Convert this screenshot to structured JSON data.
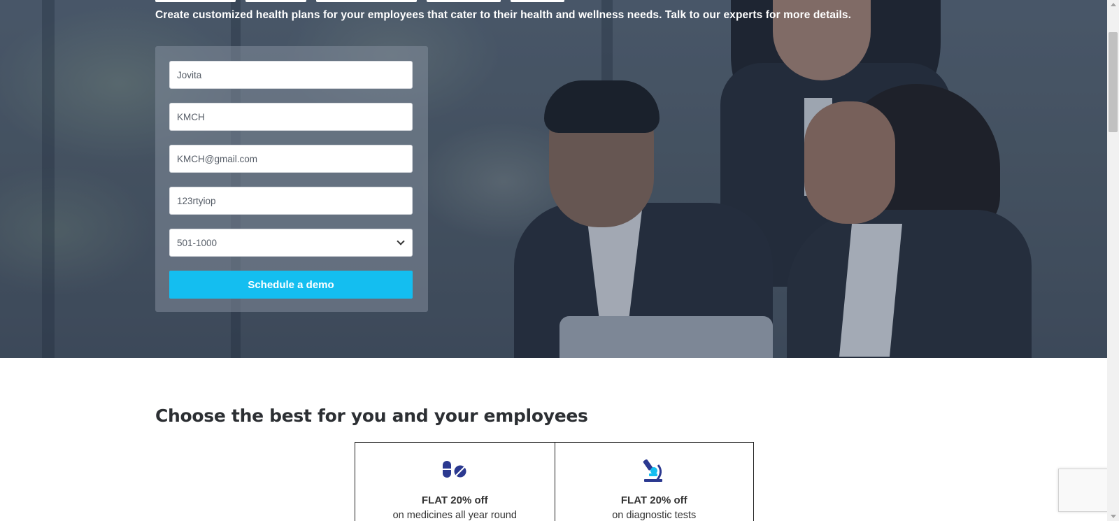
{
  "hero": {
    "subtitle": "Create customized health plans for your employees that cater to their health and wellness needs. Talk to our experts for more details."
  },
  "form": {
    "name_value": "Jovita",
    "company_value": "KMCH",
    "email_value": "KMCH@gmail.com",
    "phone_value": "123rtyiop",
    "company_size_selected": "501-1000",
    "submit_label": "Schedule a demo"
  },
  "offers_section": {
    "title": "Choose the best for you and your employees",
    "offers": [
      {
        "icon": "medicine-pills-icon",
        "headline": "FLAT 20% off",
        "detail": "on medicines all year round"
      },
      {
        "icon": "microscope-icon",
        "headline": "FLAT 20% off",
        "detail": "on diagnostic tests"
      }
    ]
  },
  "colors": {
    "accent": "#14bef0",
    "icon_blue": "#2b3990",
    "icon_cyan": "#14bef0",
    "heading": "#2c2f33"
  }
}
